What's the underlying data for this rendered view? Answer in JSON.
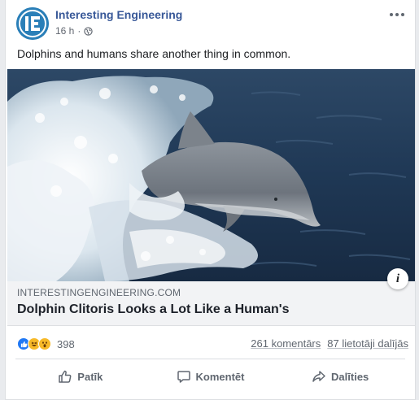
{
  "post": {
    "page_name": "Interesting Engineering",
    "time": "16 h",
    "separator": "·",
    "text": "Dolphins and humans share another thing in common.",
    "avatar_letters": "IE"
  },
  "link": {
    "domain": "INTERESTINGENGINEERING.COM",
    "title": "Dolphin Clitoris Looks a Lot Like a Human's",
    "info_label": "i"
  },
  "engagement": {
    "reaction_count": "398",
    "comments": "261 komentārs",
    "shares": "87 lietotāji dalījās",
    "reactions": [
      "like-icon",
      "haha-icon",
      "wow-icon"
    ]
  },
  "actions": {
    "like": "Patīk",
    "comment": "Komentēt",
    "share": "Dalīties"
  },
  "colors": {
    "page_name": "#385898",
    "like_blue": "#2078f4",
    "meta_gray": "#616770"
  }
}
